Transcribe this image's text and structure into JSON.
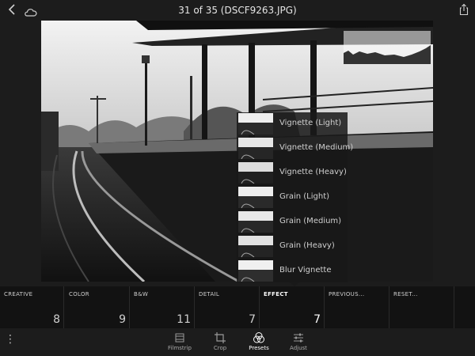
{
  "header": {
    "title": "31 of 35 (DSCF9263.JPG)"
  },
  "presets": [
    {
      "label": "Vignette (Light)"
    },
    {
      "label": "Vignette (Medium)"
    },
    {
      "label": "Vignette (Heavy)"
    },
    {
      "label": "Grain (Light)"
    },
    {
      "label": "Grain (Medium)"
    },
    {
      "label": "Grain (Heavy)"
    },
    {
      "label": "Blur Vignette"
    }
  ],
  "categories": [
    {
      "name": "CREATIVE",
      "count": "8"
    },
    {
      "name": "COLOR",
      "count": "9"
    },
    {
      "name": "B&W",
      "count": "11"
    },
    {
      "name": "DETAIL",
      "count": "7"
    },
    {
      "name": "EFFECT",
      "count": "7",
      "active": true
    },
    {
      "name": "PREVIOUS...",
      "count": ""
    },
    {
      "name": "RESET...",
      "count": ""
    }
  ],
  "toolbar": {
    "filmstrip": "Filmstrip",
    "crop": "Crop",
    "presets": "Presets",
    "adjust": "Adjust",
    "active": "Presets"
  },
  "icons": {
    "back": "chevron-left-icon",
    "cloud": "cloud-icon",
    "share": "share-icon",
    "more": "more-vertical-icon"
  },
  "colors": {
    "background": "#1c1c1c",
    "category_bar": "#121212",
    "active_text": "#ffffff"
  }
}
